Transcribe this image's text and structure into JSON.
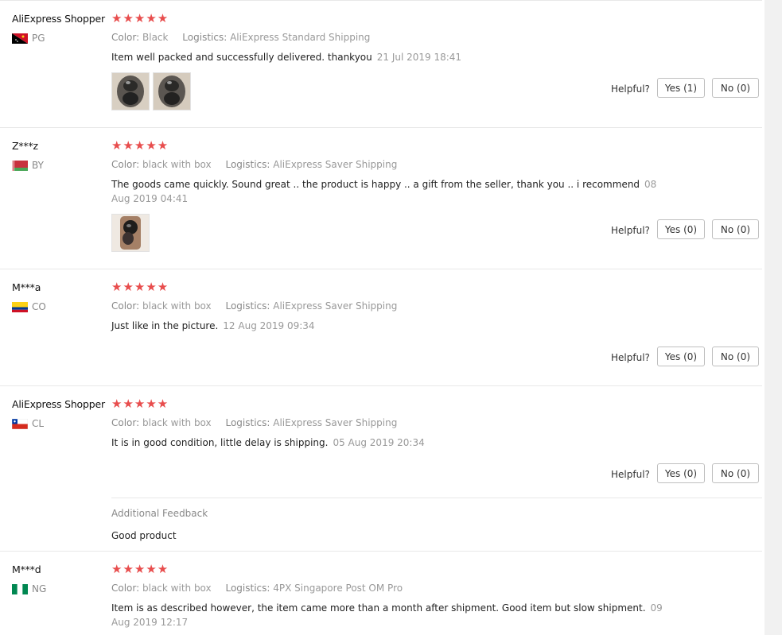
{
  "helpful_label": "Helpful?",
  "color_label": "Color:",
  "logistics_label": "Logistics:",
  "stars": "★★★★★",
  "reviews": [
    {
      "name": "AliExpress Shopper",
      "country": "PG",
      "flag": "papua-new-guinea-flag-icon",
      "color": "Black",
      "logistics": "AliExpress Standard Shipping",
      "text": "Item well packed and successfully delivered. thankyou",
      "date": "21 Jul 2019 18:41",
      "yes": "Yes (1)",
      "no": "No (0)"
    },
    {
      "name": "Z***z",
      "country": "BY",
      "flag": "belarus-flag-icon",
      "color": "black with box",
      "logistics": "AliExpress Saver Shipping",
      "text": "The goods came quickly. Sound great .. the product is happy .. a gift from the seller, thank you .. i recommend",
      "date": "08 Aug 2019 04:41",
      "yes": "Yes (0)",
      "no": "No (0)"
    },
    {
      "name": "M***a",
      "country": "CO",
      "flag": "colombia-flag-icon",
      "color": "black with box",
      "logistics": "AliExpress Saver Shipping",
      "text": "Just like in the picture.",
      "date": "12 Aug 2019 09:34",
      "yes": "Yes (0)",
      "no": "No (0)"
    },
    {
      "name": "AliExpress Shopper",
      "country": "CL",
      "flag": "chile-flag-icon",
      "color": "black with box",
      "logistics": "AliExpress Saver Shipping",
      "text": "It is in good condition, little delay is shipping.",
      "date": "05 Aug 2019 20:34",
      "yes": "Yes (0)",
      "no": "No (0)",
      "additional_feedback_title": "Additional Feedback",
      "additional_feedback_text": "Good product"
    },
    {
      "name": "M***d",
      "country": "NG",
      "flag": "nigeria-flag-icon",
      "color": "black with box",
      "logistics": "4PX Singapore Post OM Pro",
      "text": "Item is as described however, the item came more than a month after shipment. Good item but slow shipment.",
      "date": "09 Aug 2019 12:17"
    }
  ],
  "colors": {
    "star": "#e84d4d",
    "muted": "#999999",
    "border": "#e8e8e8"
  }
}
